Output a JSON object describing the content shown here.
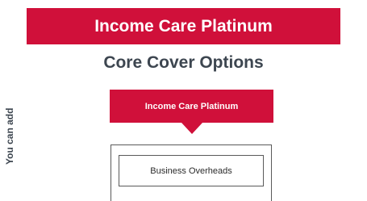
{
  "banner": {
    "title": "Income Care Platinum"
  },
  "section": {
    "title": "Core Cover Options"
  },
  "side_label": "You can add",
  "core_option": {
    "label": "Income Care Platinum"
  },
  "addons": [
    {
      "label": "Business Overheads"
    }
  ],
  "colors": {
    "brand": "#d0103a",
    "heading": "#3d4650",
    "border": "#5a5a5a"
  }
}
